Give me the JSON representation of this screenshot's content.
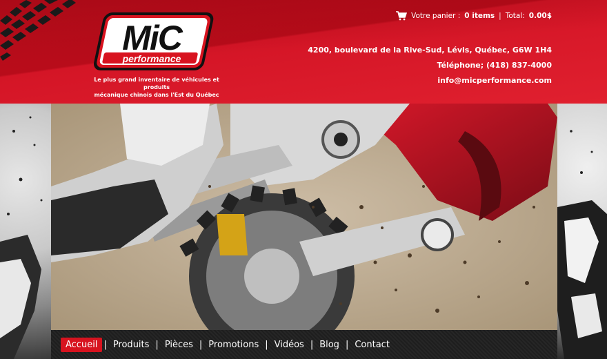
{
  "colors": {
    "brand_red": "#d41526",
    "nav_background": "#222222",
    "active_tab": "#d7131f",
    "text": "#ffffff"
  },
  "header": {
    "logo_main": "MiC",
    "logo_sub": "performance",
    "tagline_line1": "Le plus grand inventaire de véhicules et produits",
    "tagline_line2": "mécanique chinois dans l'Est du Québec"
  },
  "cart": {
    "icon": "cart-icon",
    "label": "Votre panier :",
    "items": "0 items",
    "separator": "|",
    "total_label": "Total:",
    "total_value": "0.00$"
  },
  "contact": {
    "address": "4200, boulevard de la Rive-Sud, Lévis, Québec, G6W 1H4",
    "phone": "Téléphone; (418) 837-4000",
    "email": "info@micperformance.com"
  },
  "hero": {
    "image": "motocross-dirt-bike-photo"
  },
  "nav": {
    "separator": "|",
    "items": [
      {
        "label": "Accueil",
        "active": true
      },
      {
        "label": "Produits",
        "active": false
      },
      {
        "label": "Pièces",
        "active": false
      },
      {
        "label": "Promotions",
        "active": false
      },
      {
        "label": "Vidéos",
        "active": false
      },
      {
        "label": "Blog",
        "active": false
      },
      {
        "label": "Contact",
        "active": false
      }
    ]
  }
}
